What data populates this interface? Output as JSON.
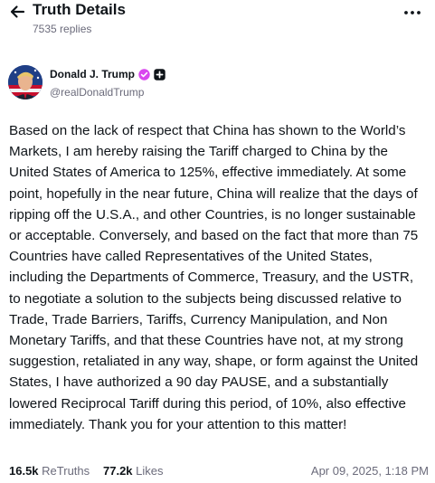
{
  "header": {
    "title": "Truth Details",
    "replies": "7535 replies"
  },
  "author": {
    "name": "Donald J. Trump",
    "handle": "@realDonaldTrump"
  },
  "post": {
    "text": "Based on the lack of respect that China has shown to the World’s Markets, I am hereby raising the Tariff charged to China by the United States of America to 125%, effective immediately. At some point, hopefully in the near future, China will realize that the days of ripping off the U.S.A., and other Countries, is no longer sustainable or acceptable. Conversely, and based on the fact that more than 75 Countries have called Representatives of the United States, including the Departments of Commerce, Treasury, and the USTR, to negotiate a solution to the subjects being discussed relative to Trade, Trade Barriers, Tariffs, Currency Manipulation, and Non Monetary Tariffs, and that these Countries have not, at my strong suggestion, retaliated in any way, shape, or form against the United States, I have authorized a 90 day PAUSE, and a substantially lowered Reciprocal Tariff during this period, of 10%, also effective immediately. Thank you for your attention to this matter!"
  },
  "stats": {
    "retruths_count": "16.5k",
    "retruths_label": "ReTruths",
    "likes_count": "77.2k",
    "likes_label": "Likes",
    "timestamp": "Apr 09, 2025, 1:18 PM"
  },
  "colors": {
    "text": "#0f1419",
    "muted": "#6b6b7b",
    "verified_badge": "#d946ef",
    "background": "#ffffff"
  },
  "icons": {
    "back": "arrow-left-icon",
    "more": "more-horizontal-icon",
    "verified": "verified-badge-icon",
    "plus": "plus-badge-icon"
  }
}
